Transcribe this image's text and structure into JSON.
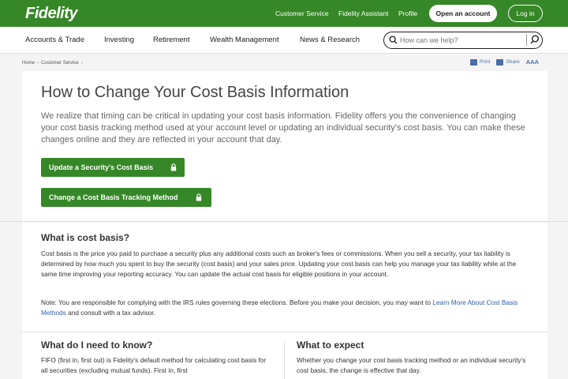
{
  "header": {
    "logo": "Fidelity",
    "links": [
      "Customer Service",
      "Fidelity Assistant",
      "Profile"
    ],
    "open_account": "Open an account",
    "login": "Log in"
  },
  "nav": {
    "items": [
      "Accounts & Trade",
      "Investing",
      "Retirement",
      "Wealth Management",
      "News & Research"
    ],
    "search_placeholder": "How can we help?"
  },
  "breadcrumb": {
    "items": [
      "Home",
      "Customer Service"
    ]
  },
  "tools": {
    "print": "Print",
    "share": "Share",
    "text_size": "AAA"
  },
  "main": {
    "title": "How to Change Your Cost Basis Information",
    "intro": "We realize that timing can be critical in updating your cost basis information. Fidelity offers you the convenience of changing your cost basis tracking method used at your account level or updating an individual security's cost basis. You can make these changes online and they are reflected in your account that day.",
    "btn_update": "Update a Security's Cost Basis",
    "btn_change": "Change a Cost Basis Tracking Method"
  },
  "cost_basis": {
    "heading": "What is cost basis?",
    "body": "Cost basis is the price you paid to purchase a security plus any additional costs such as broker's fees or commissions. When you sell a security, your tax liability is determined by how much you spent to buy the security (cost basis) and your sales price. Updating your cost basis can help you manage your tax liability while at the same time improving your reporting accuracy. You can update the actual cost basis for eligible positions in your account.",
    "note_prefix": "Note: You are responsible for complying with the IRS rules governing these elections. Before you make your decision, you may want to",
    "note_link": "Learn More About Cost Basis Methods",
    "note_suffix": " and consult with a tax advisor."
  },
  "know": {
    "heading": "What do I need to know?",
    "body": "FIFO (first in, first out) is Fidelity's default method for calculating cost basis for all securities (excluding mutual funds). First in, first"
  },
  "expect": {
    "heading": "What to expect",
    "body": "Whether you change your cost basis tracking method or an individual security's cost basis, the change is effective that day."
  },
  "colors": {
    "brand_green": "#368727",
    "link_blue": "#2c5fa8"
  }
}
